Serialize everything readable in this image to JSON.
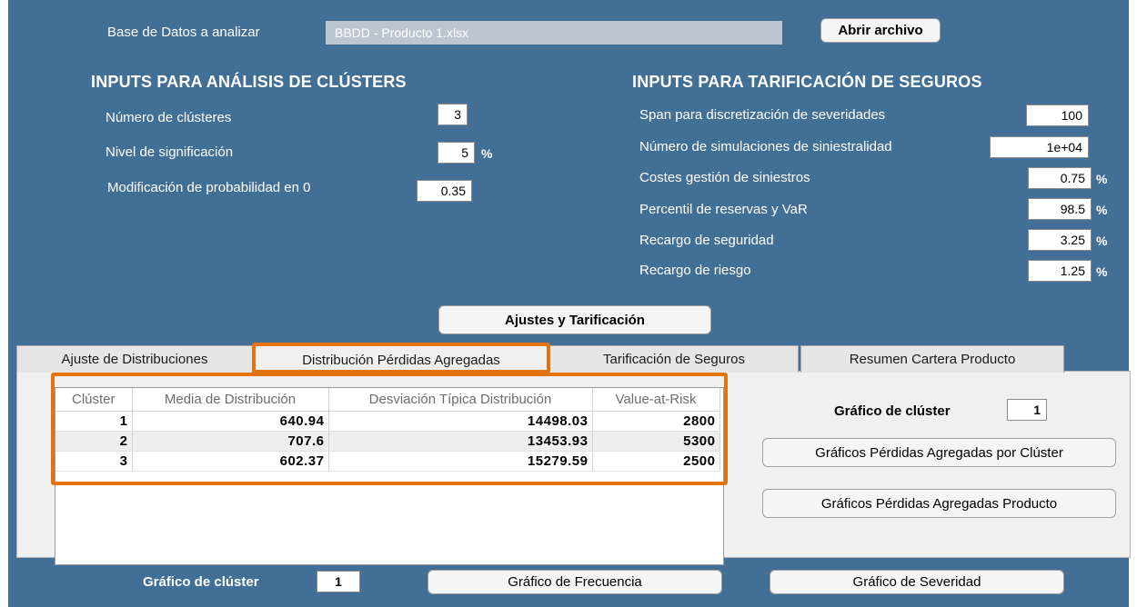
{
  "top": {
    "db_label": "Base de Datos a analizar",
    "db_value": "BBDD - Producto 1.xlsx",
    "open_button": "Abrir archivo"
  },
  "clusters": {
    "title": "INPUTS PARA ANÁLISIS DE CLÚSTERS",
    "num_label": "Número de clústeres",
    "num_value": "3",
    "sig_label": "Nivel de significación",
    "sig_value": "5",
    "sig_unit": "%",
    "prob_label": "Modificación de probabilidad en 0",
    "prob_value": "0.35"
  },
  "pricing": {
    "title": "INPUTS PARA TARIFICACIÓN DE SEGUROS",
    "span_label": "Span para discretización de severidades",
    "span_value": "100",
    "sims_label": "Número de simulaciones de siniestralidad",
    "sims_value": "1e+04",
    "costs_label": "Costes gestión de siniestros",
    "costs_value": "0.75",
    "pctl_label": "Percentil de reservas y VaR",
    "pctl_value": "98.5",
    "safety_label": "Recargo de seguridad",
    "safety_value": "3.25",
    "risk_label": "Recargo de riesgo",
    "risk_value": "1.25",
    "unit": "%"
  },
  "adjust_button": "Ajustes y Tarificación",
  "tabs": [
    {
      "label": "Ajuste de Distribuciones"
    },
    {
      "label": "Distribución Pérdidas Agregadas"
    },
    {
      "label": "Tarificación de Seguros"
    },
    {
      "label": "Resumen Cartera Producto"
    }
  ],
  "table": {
    "headers": [
      "Clúster",
      "Media de Distribución",
      "Desviación Típica Distribución",
      "Value-at-Risk"
    ],
    "rows": [
      [
        "1",
        "640.94",
        "14498.03",
        "2800"
      ],
      [
        "2",
        "707.6",
        "13453.93",
        "5300"
      ],
      [
        "3",
        "602.37",
        "15279.59",
        "2500"
      ]
    ]
  },
  "side": {
    "graph_label": "Gráfico de clúster",
    "graph_value": "1",
    "btn_by_cluster": "Gráficos Pérdidas Agregadas por Clúster",
    "btn_product": "Gráficos Pérdidas Agregadas Producto"
  },
  "bottom": {
    "graph_label": "Gráfico de clúster",
    "graph_value": "1",
    "freq_button": "Gráfico de Frecuencia",
    "sev_button": "Gráfico de Severidad"
  },
  "colors": {
    "background": "#426f96",
    "highlight": "#e3720f",
    "panel": "#f0f0f0"
  }
}
